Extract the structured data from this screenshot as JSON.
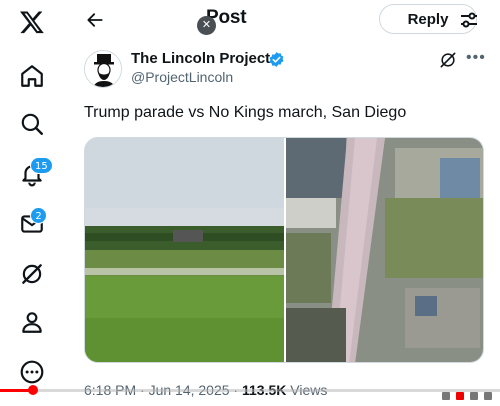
{
  "sidebar": {
    "items": [
      {
        "name": "x-logo",
        "badge": null
      },
      {
        "name": "home",
        "badge": null
      },
      {
        "name": "explore",
        "badge": null
      },
      {
        "name": "notifications",
        "badge": "15"
      },
      {
        "name": "messages",
        "badge": "2"
      },
      {
        "name": "grok",
        "badge": null
      },
      {
        "name": "profile",
        "badge": null
      },
      {
        "name": "more",
        "badge": null
      }
    ]
  },
  "header": {
    "title": "Post",
    "reply_label": "Reply"
  },
  "post": {
    "author_name": "The Lincoln Project",
    "handle": "@ProjectLincoln",
    "text": "Trump parade vs No Kings march, San Diego",
    "time": "6:18 PM · Jun 14, 2025 · ",
    "views_count": "113.5K",
    "views_label": " Views",
    "verified_color": "#1d9bf0"
  },
  "notifications_badge": "15",
  "messages_badge": "2",
  "colors": {
    "accent": "#1d9bf0",
    "text": "#0f1419",
    "muted": "#536471",
    "progress": "#ff0000"
  },
  "video": {
    "progress": 0.065
  }
}
